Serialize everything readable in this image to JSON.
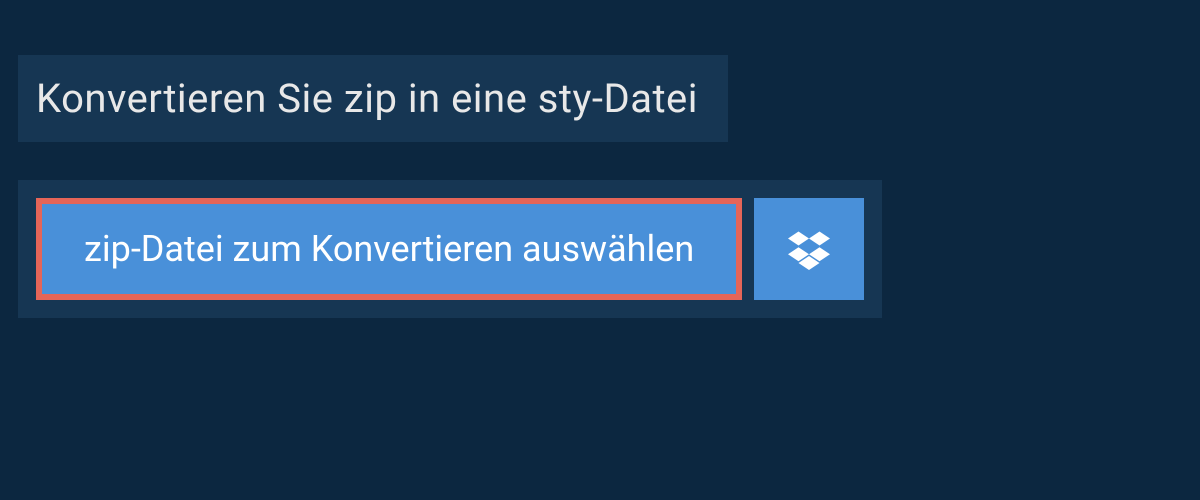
{
  "title": "Konvertieren Sie zip in eine sty-Datei",
  "buttons": {
    "select_file": "zip-Datei zum Konvertieren auswählen"
  },
  "colors": {
    "background": "#0c2740",
    "panel": "#163653",
    "button": "#4990d9",
    "highlight_border": "#e56558",
    "text_light": "#e8e8e8",
    "text_white": "#ffffff"
  }
}
